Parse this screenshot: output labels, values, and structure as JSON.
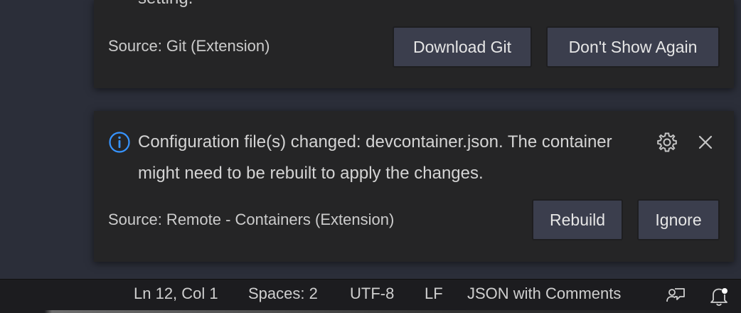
{
  "notifications": [
    {
      "partial_message": "setting.",
      "source": "Source: Git (Extension)",
      "actions": [
        "Download Git",
        "Don't Show Again"
      ]
    },
    {
      "icon": "info-icon",
      "message": "Configuration file(s) changed: devcontainer.json. The container might need to be rebuilt to apply the changes.",
      "source": "Source: Remote - Containers (Extension)",
      "actions": [
        "Rebuild",
        "Ignore"
      ],
      "toolbar_icons": [
        "gear-icon",
        "close-icon"
      ]
    }
  ],
  "statusbar": {
    "position": "Ln 12, Col 1",
    "indentation": "Spaces: 2",
    "encoding": "UTF-8",
    "line_ending": "LF",
    "language": "JSON with Comments",
    "icons": [
      "feedback-icon",
      "notifications-bell-icon"
    ]
  },
  "colors": {
    "info_accent": "#3794ff",
    "notification_bg": "#252526",
    "button_bg": "#3b3e4d",
    "statusbar_bg": "#1c1c1f"
  }
}
